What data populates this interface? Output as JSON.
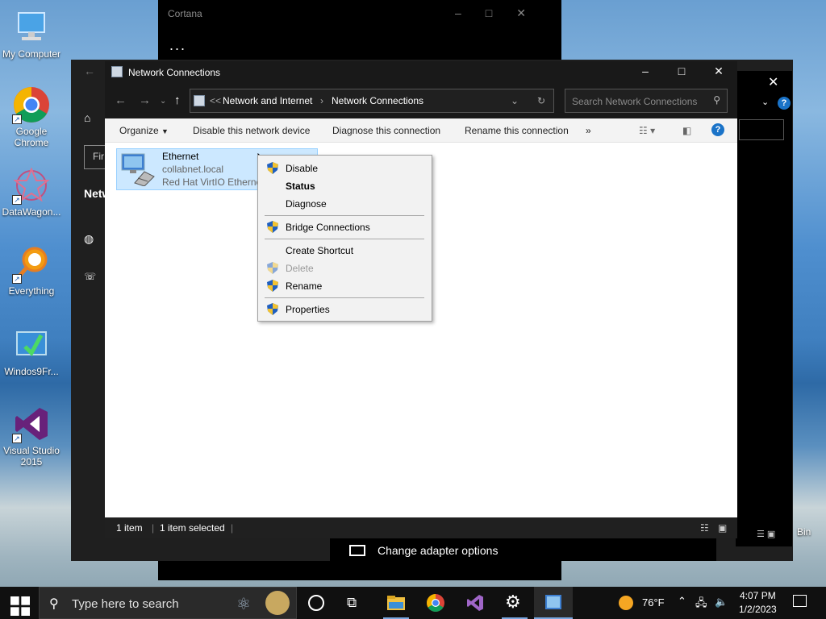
{
  "desktop": {
    "icons": [
      {
        "label": "My Computer"
      },
      {
        "label": "Google Chrome"
      },
      {
        "label": "DataWagon..."
      },
      {
        "label": "Everything"
      },
      {
        "label": "Windos9Fr..."
      },
      {
        "label": "Visual Studio 2015"
      }
    ],
    "recycle_label": "Bin"
  },
  "cortana": {
    "title": "Cortana",
    "more": "..."
  },
  "settings": {
    "find_placeholder": "Fir",
    "nav_label": "Netw"
  },
  "explorer": {
    "title": "Network Connections",
    "breadcrumb": {
      "overflow": "<<",
      "items": [
        "Network and Internet",
        "Network Connections"
      ]
    },
    "search_placeholder": "Search Network Connections",
    "commands": {
      "organize": "Organize",
      "disable": "Disable this network device",
      "diagnose": "Diagnose this connection",
      "rename": "Rename this connection",
      "more": "»"
    },
    "item": {
      "name": "Ethernet",
      "domain": "collabnet.local",
      "adapter": "Red Hat VirtIO Ethernet"
    },
    "status": {
      "count": "1 item",
      "selected": "1 item selected"
    }
  },
  "context_menu": {
    "disable": "Disable",
    "status": "Status",
    "diagnose": "Diagnose",
    "bridge": "Bridge Connections",
    "shortcut": "Create Shortcut",
    "delete": "Delete",
    "rename": "Rename",
    "properties": "Properties"
  },
  "adapter_bar": {
    "label": "Change adapter options"
  },
  "taskbar": {
    "search_placeholder": "Type here to search",
    "weather": "76°F",
    "time": "4:07 PM",
    "date": "1/2/2023"
  },
  "colors": {
    "accent": "#1a73c8",
    "selection": "#cce8ff",
    "shield_blue": "#1f5fbf",
    "shield_yellow": "#f2c230"
  }
}
